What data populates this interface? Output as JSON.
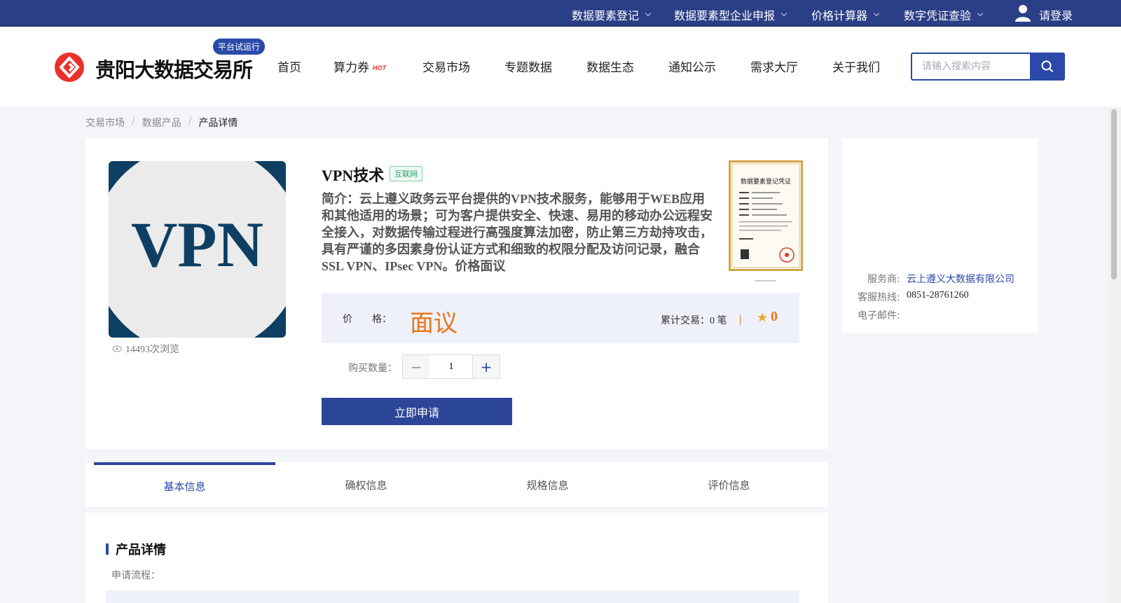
{
  "topbar": {
    "items": [
      "数据要素登记",
      "数据要素型企业申报",
      "价格计算器",
      "数字凭证查验"
    ],
    "login": "请登录"
  },
  "header": {
    "logo_text": "贵阳大数据交易所",
    "trial_badge": "平台试运行",
    "nav": [
      "首页",
      "算力券",
      "交易市场",
      "专题数据",
      "数据生态",
      "通知公示",
      "需求大厅",
      "关于我们"
    ],
    "hot_label": "HOT",
    "search_placeholder": "请输入搜索内容"
  },
  "breadcrumb": [
    "交易市场",
    "数据产品",
    "产品详情"
  ],
  "product": {
    "image_text": "VPN",
    "views": "14493次浏览",
    "title": "VPN技术",
    "category": "互联网",
    "intro": "简介：云上遵义政务云平台提供的VPN技术服务，能够用于WEB应用和其他适用的场景；可为客户提供安全、快速、易用的移动办公远程安全接入，对数据传输过程进行高强度算法加密，防止第三方劫持攻击，具有严谨的多因素身份认证方式和细致的权限分配及访问记录，融合SSL VPN、IPsec VPN。价格面议",
    "cert_title": "数据要素登记凭证",
    "price_label": "价　　格：",
    "price_value": "面议",
    "trades": "累计交易：0 笔",
    "rating": "0",
    "qty_label": "购买数量：",
    "qty_value": "1",
    "qty_minus": "−",
    "qty_plus": "+",
    "apply_button": "立即申请"
  },
  "provider": {
    "service_label": "服务商:",
    "service_value": "云上遵义大数据有限公司",
    "hotline_label": "客服热线:",
    "hotline_value": "0851-28761260",
    "email_label": "电子邮件:",
    "email_value": ""
  },
  "tabs": [
    "基本信息",
    "确权信息",
    "规格信息",
    "评价信息"
  ],
  "detail": {
    "title": "产品详情",
    "flow_label": "申请流程："
  },
  "colors": {
    "brand": "#2b3f86",
    "accent": "#2b49a8",
    "price": "#e8761a",
    "logo_red": "#e8312a"
  }
}
